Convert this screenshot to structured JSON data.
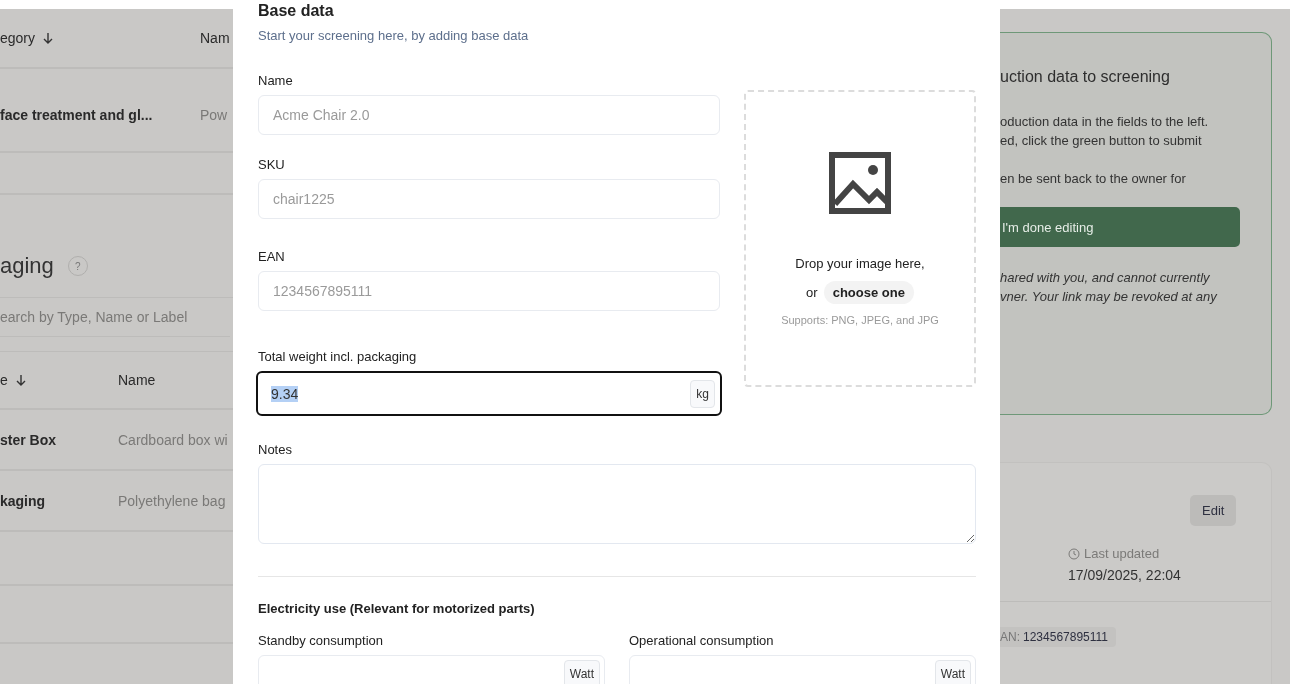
{
  "background_left": {
    "table_header": [
      {
        "label": "egory",
        "sorted": true
      },
      {
        "label": "Nam"
      }
    ],
    "table_rows": [
      {
        "cells": [
          "face treatment and gl...",
          "Pow"
        ]
      }
    ],
    "packaging_title": "aging",
    "help_label": "?",
    "search": {
      "placeholder": "earch by Type, Name or Label"
    },
    "packaging_header": [
      {
        "label": "e",
        "sorted": true
      },
      {
        "label": "Name",
        "sorted": false
      }
    ],
    "packaging_rows": [
      {
        "cells": [
          "ster Box",
          "Cardboard box wi"
        ]
      },
      {
        "cells": [
          "kaging",
          "Polyethylene bag"
        ]
      }
    ]
  },
  "modal": {
    "title": "Base data",
    "subtitle": "Start your screening here, by adding base data",
    "fields": [
      {
        "label": "Name",
        "placeholder": "Acme Chair 2.0",
        "focused": false
      },
      {
        "label": "SKU",
        "placeholder": "chair1225",
        "focused": false
      },
      {
        "label": "EAN",
        "placeholder": "1234567895111",
        "focused": false
      },
      {
        "label": "Total weight incl. packaging",
        "value": "9.34",
        "unit": "kg",
        "focused": true
      }
    ],
    "dropzone": {
      "text": "Drop your image here,",
      "or": "or",
      "choose": "choose one",
      "supports": "Supports: PNG, JPEG, and JPG"
    },
    "notes": {
      "label": "Notes"
    },
    "electricity": {
      "title": "Electricity use (Relevant for motorized parts)",
      "fields": [
        {
          "label": "Standby consumption",
          "unit": "Watt"
        },
        {
          "label": "Operational consumption",
          "unit": "Watt"
        }
      ]
    }
  },
  "background_right": {
    "card_title": "uction data to screening",
    "paragraphs": [
      [
        "oduction data in the fields to the left.",
        "ed, click the green button to submit"
      ],
      [
        "en be sent back to the owner for"
      ]
    ],
    "done_button": "I'm done editing",
    "note_lines": [
      "hared with you, and cannot currently",
      "vner. Your link may be revoked at any"
    ],
    "edit_button": "Edit",
    "last_updated_label": "Last updated",
    "last_updated": "17/09/2025, 22:04",
    "ean_label": "AN:",
    "ean_value": "1234567895111"
  }
}
